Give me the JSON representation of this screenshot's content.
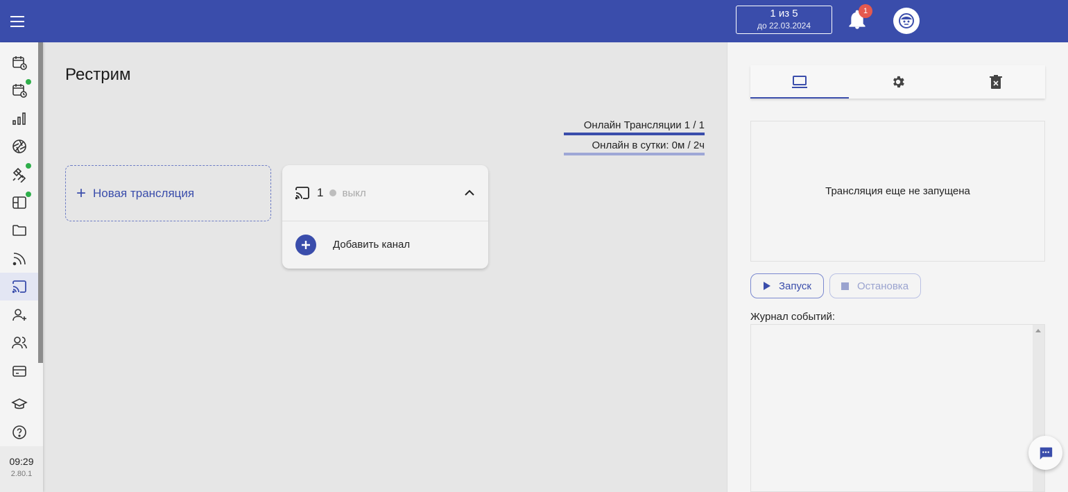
{
  "header": {
    "plan_line1": "1 из 5",
    "plan_line2": "до 22.03.2024",
    "notifications_count": "1"
  },
  "sidebar": {
    "items": [
      {
        "icon": "calendar-clock-icon",
        "badge": false
      },
      {
        "icon": "calendar-clock-icon",
        "badge": true
      },
      {
        "icon": "bar-chart-icon",
        "badge": false
      },
      {
        "icon": "aperture-icon",
        "badge": false
      },
      {
        "icon": "satellite-icon",
        "badge": true
      },
      {
        "icon": "layout-icon",
        "badge": true
      },
      {
        "icon": "folder-icon",
        "badge": false
      },
      {
        "icon": "rss-icon",
        "badge": false
      },
      {
        "icon": "cast-icon",
        "badge": false,
        "active": true
      },
      {
        "icon": "user-plus-icon",
        "badge": false
      },
      {
        "icon": "users-icon",
        "badge": false
      },
      {
        "icon": "credit-card-icon",
        "badge": false
      },
      {
        "icon": "graduation-cap-icon",
        "badge": false
      },
      {
        "icon": "help-circle-icon",
        "badge": false
      }
    ],
    "time": "09:29",
    "version": "2.80.1"
  },
  "main": {
    "title": "Рестрим",
    "stats": {
      "online_streams": "Онлайн Трансляции 1 / 1",
      "online_per_day": "Онлайн в сутки: 0м / 2ч",
      "online_streams_fraction": 1.0,
      "online_per_day_fraction": 1.0
    },
    "new_stream_label": "Новая трансляция",
    "stream_card": {
      "number": "1",
      "status": "выкл",
      "add_channel_label": "Добавить канал"
    }
  },
  "right_panel": {
    "tabs": [
      "laptop-icon",
      "gear-icon",
      "trash-icon"
    ],
    "preview_text": "Трансляция еще не запущена",
    "start_label": "Запуск",
    "stop_label": "Остановка",
    "log_label": "Журнал событий:"
  },
  "colors": {
    "primary": "#3a4dab",
    "badge": "#e5594e",
    "online_dot": "#2eae4a"
  }
}
